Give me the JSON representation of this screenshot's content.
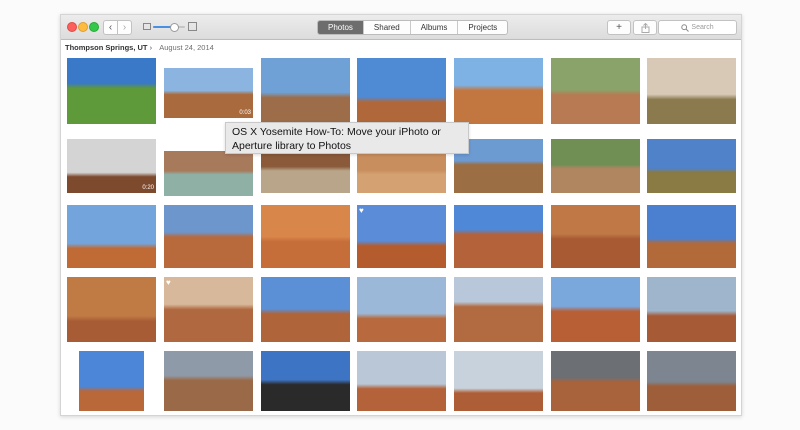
{
  "window": {
    "back_glyph": "‹",
    "forward_glyph": "›",
    "tabs": [
      {
        "label": "Photos",
        "active": true
      },
      {
        "label": "Shared",
        "active": false
      },
      {
        "label": "Albums",
        "active": false
      },
      {
        "label": "Projects",
        "active": false
      }
    ],
    "add_glyph": "+",
    "search_placeholder": "Search",
    "zoom_level": 0.65
  },
  "moment": {
    "location": "Thompson Springs, UT",
    "chevron": "›",
    "date": "August 24, 2014"
  },
  "tooltip": {
    "line1": "OS X Yosemite How-To: Move your iPhoto or",
    "line2": "Aperture library to Photos"
  },
  "photos": [
    {
      "scene": "horse-riders-meadow",
      "sky": "#3a78c8",
      "ground": "#5e9a3a"
    },
    {
      "scene": "horse-rider-red-hills",
      "sky": "#8bb5e0",
      "ground": "#a96b3d",
      "badge": "0:03"
    },
    {
      "scene": "rider-on-horse",
      "sky": "#6fa1d6",
      "ground": "#9c6d48"
    },
    {
      "scene": "canyon-overlook",
      "sky": "#4f8ad4",
      "ground": "#b0683a"
    },
    {
      "scene": "monument-valley",
      "sky": "#7eb2e5",
      "ground": "#c37740"
    },
    {
      "scene": "hiker-canyon",
      "sky": "#8aa36a",
      "ground": "#b87a52"
    },
    {
      "scene": "canyon-creek",
      "sky": "#d8c9b6",
      "ground": "#8a7a4e"
    },
    {
      "scene": "waterfall-rocks",
      "sky": "#d4d4d4",
      "ground": "#7e4a2e",
      "badge": "0:20"
    },
    {
      "scene": "swimmer-pool",
      "sky": "#a87a5c",
      "ground": "#8fb0a5"
    },
    {
      "scene": "canyon-stream",
      "sky": "#8a5a3a",
      "ground": "#b9a58a"
    },
    {
      "scene": "sandstone-ripples",
      "sky": "#c98e5e",
      "ground": "#d4a272"
    },
    {
      "scene": "river-valley",
      "sky": "#6c9bd2",
      "ground": "#9c6e44"
    },
    {
      "scene": "hiker-jump-river",
      "sky": "#6f8f55",
      "ground": "#b08660"
    },
    {
      "scene": "green-valley",
      "sky": "#4f82c8",
      "ground": "#8a7a44"
    },
    {
      "scene": "butte-rider",
      "sky": "#74a4dc",
      "ground": "#c06a35"
    },
    {
      "scene": "hikers-arch",
      "sky": "#6d96cc",
      "ground": "#b96a3c"
    },
    {
      "scene": "red-slickrock",
      "sky": "#d9864a",
      "ground": "#c66e3a"
    },
    {
      "scene": "delicate-arch",
      "sky": "#5a8cd8",
      "ground": "#b55c2e",
      "heart": true
    },
    {
      "scene": "arch-hiker-green",
      "sky": "#4e88d6",
      "ground": "#b3623a"
    },
    {
      "scene": "selfie-arch",
      "sky": "#bf7846",
      "ground": "#a85a32"
    },
    {
      "scene": "arch-blue-sky",
      "sky": "#4b7fd0",
      "ground": "#b26a3a"
    },
    {
      "scene": "woman-arch-window",
      "sky": "#c07a44",
      "ground": "#a85c36"
    },
    {
      "scene": "couple-selfie",
      "sky": "#d8b89a",
      "ground": "#b06840",
      "heart": true
    },
    {
      "scene": "arches-clouds",
      "sky": "#5b8fd6",
      "ground": "#b0643a"
    },
    {
      "scene": "rock-formation",
      "sky": "#9cb8d8",
      "ground": "#b86a3e"
    },
    {
      "scene": "arch-cloudy",
      "sky": "#b8c8da",
      "ground": "#b26a40"
    },
    {
      "scene": "hiker-arch-red",
      "sky": "#7aa8dc",
      "ground": "#b85f36"
    },
    {
      "scene": "couple-arch",
      "sky": "#9fb5cc",
      "ground": "#a65a35"
    },
    {
      "scene": "arch-small",
      "sky": "#4b86d8",
      "ground": "#b9683a"
    },
    {
      "scene": "storm-plateau",
      "sky": "#8f9aa8",
      "ground": "#9a6a48"
    },
    {
      "scene": "hiker-silhouette",
      "sky": "#3d74c4",
      "ground": "#2a2a2a"
    },
    {
      "scene": "red-fins",
      "sky": "#b9c7d6",
      "ground": "#b4623a"
    },
    {
      "scene": "rock-spires",
      "sky": "#c8d2dc",
      "ground": "#ae5e36"
    },
    {
      "scene": "hiker-dark-sky",
      "sky": "#6c6f74",
      "ground": "#a8623c"
    },
    {
      "scene": "storm-clouds",
      "sky": "#7d8590",
      "ground": "#9e5e3a"
    }
  ]
}
